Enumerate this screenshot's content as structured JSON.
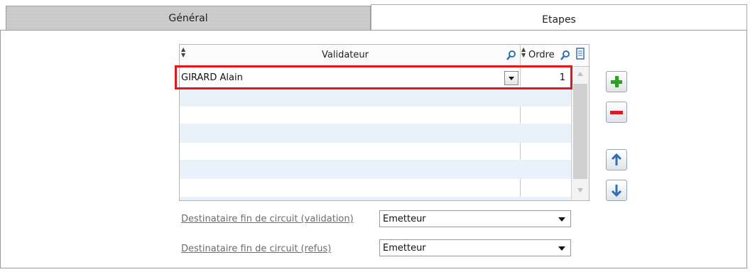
{
  "tabs": [
    {
      "label": "Général"
    },
    {
      "label": "Etapes"
    }
  ],
  "grid": {
    "columns": [
      "Validateur",
      "Ordre"
    ],
    "rows": [
      {
        "validateur": "GIRARD Alain",
        "ordre": "1"
      }
    ]
  },
  "fields": {
    "validation": {
      "label": "Destinataire fin de circuit (validation)",
      "value": "Emetteur"
    },
    "refus": {
      "label": "Destinataire fin de circuit (refus)",
      "value": "Emetteur"
    }
  },
  "colors": {
    "highlight": "#e3161c",
    "add": "#2aa320",
    "remove": "#d81b22",
    "arrows": "#2f6fb5"
  },
  "icons": [
    "search-icon",
    "column-chooser-icon",
    "add-icon",
    "remove-icon",
    "arrow-up-icon",
    "arrow-down-icon"
  ]
}
